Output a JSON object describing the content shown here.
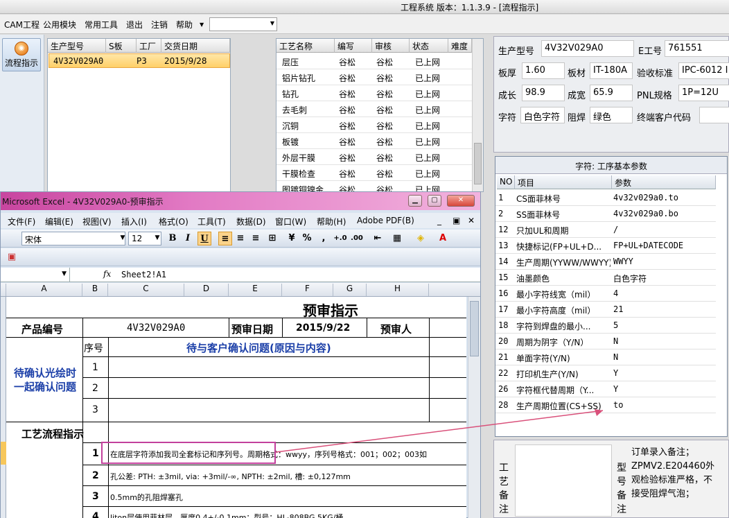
{
  "app": {
    "title": "工程系统   版本：1.1.3.9 - [流程指示]"
  },
  "menu": {
    "items": [
      "CAM工程",
      "公用模块",
      "常用工具",
      "退出",
      "注销",
      "帮助"
    ],
    "dropdown_value": ""
  },
  "sidebar": {
    "flow_button": "流程指示"
  },
  "orders": {
    "headers": [
      "生产型号",
      "S板",
      "工厂",
      "交货日期"
    ],
    "rows": [
      {
        "model": "4V32V029A0",
        "s": "",
        "factory": "P3",
        "date": "2015/9/28"
      }
    ]
  },
  "process": {
    "headers": [
      "工艺名称",
      "编写",
      "审核",
      "状态",
      "难度"
    ],
    "rows": [
      {
        "name": "层压",
        "writer": "谷松",
        "reviewer": "谷松",
        "status": "已上网"
      },
      {
        "name": "铝片钻孔",
        "writer": "谷松",
        "reviewer": "谷松",
        "status": "已上网"
      },
      {
        "name": "钻孔",
        "writer": "谷松",
        "reviewer": "谷松",
        "status": "已上网"
      },
      {
        "name": "去毛刺",
        "writer": "谷松",
        "reviewer": "谷松",
        "status": "已上网"
      },
      {
        "name": "沉铜",
        "writer": "谷松",
        "reviewer": "谷松",
        "status": "已上网"
      },
      {
        "name": "板镀",
        "writer": "谷松",
        "reviewer": "谷松",
        "status": "已上网"
      },
      {
        "name": "外层干膜",
        "writer": "谷松",
        "reviewer": "谷松",
        "status": "已上网"
      },
      {
        "name": "干膜检查",
        "writer": "谷松",
        "reviewer": "谷松",
        "status": "已上网"
      },
      {
        "name": "图镀铜镍金",
        "writer": "谷松",
        "reviewer": "谷松",
        "status": "已上网"
      }
    ]
  },
  "info": {
    "model_label": "生产型号",
    "model_value": "4V32V029A0",
    "eng_label": "E工号",
    "eng_value": "761551",
    "thickness_label": "板厚",
    "thickness_value": "1.60",
    "material_label": "板材",
    "material_value": "IT-180A",
    "standard_label": "验收标准",
    "standard_value": "IPC-6012 I",
    "length_label": "成长",
    "length_value": "98.9",
    "width_label": "成宽",
    "width_value": "65.9",
    "pnl_label": "PNL规格",
    "pnl_value": "1P=12U",
    "char_label": "字符",
    "char_value": "白色字符",
    "mask_label": "阻焊",
    "mask_value": "绿色",
    "customer_label": "终端客户代码",
    "customer_value": ""
  },
  "params": {
    "caption": "字符: 工序基本参数",
    "headers": [
      "NO",
      "项目",
      "参数"
    ],
    "rows": [
      {
        "no": "1",
        "item": "CS面菲林号",
        "value": "4v32v029a0.to"
      },
      {
        "no": "2",
        "item": "SS面菲林号",
        "value": "4v32v029a0.bo"
      },
      {
        "no": "12",
        "item": "只加UL和周期",
        "value": "/"
      },
      {
        "no": "13",
        "item": "快捷标记(FP+UL+D...",
        "value": "FP+UL+DATECODE"
      },
      {
        "no": "14",
        "item": "生产周期(YYWW/WWYY)",
        "value": "WWYY"
      },
      {
        "no": "15",
        "item": "油墨颜色",
        "value": "白色字符"
      },
      {
        "no": "16",
        "item": "最小字符线宽（mil）",
        "value": "4"
      },
      {
        "no": "17",
        "item": "最小字符高度（mil）",
        "value": "21"
      },
      {
        "no": "18",
        "item": "字符到焊盘的最小...",
        "value": "5"
      },
      {
        "no": "20",
        "item": "周期为阴字（Y/N）",
        "value": "N"
      },
      {
        "no": "21",
        "item": "单面字符(Y/N)",
        "value": "N"
      },
      {
        "no": "22",
        "item": "打印机生产(Y/N)",
        "value": "Y"
      },
      {
        "no": "26",
        "item": "字符框代替周期（Y...",
        "value": "Y"
      },
      {
        "no": "28",
        "item": "生产周期位置(CS+SS)",
        "value": "to"
      }
    ]
  },
  "notes": {
    "process_label": "工艺备注",
    "type_label": "型号备注",
    "order_note": "订单录入备注；ZPMV2.E204460外观检验标准严格，不接受阻焊气泡；"
  },
  "excel": {
    "title": "Microsoft Excel - 4V32V029A0-预审指示",
    "menus": [
      "文件(F)",
      "编辑(E)",
      "视图(V)",
      "插入(I)",
      "格式(O)",
      "工具(T)",
      "数据(D)",
      "窗口(W)",
      "帮助(H)",
      "Adobe PDF(B)"
    ],
    "font": "宋体",
    "size": "12",
    "formula": "Sheet2!A1",
    "fx": "fx",
    "columns": [
      "A",
      "B",
      "C",
      "D",
      "E",
      "F",
      "G",
      "H"
    ],
    "sheet": {
      "title": "预审指示",
      "product_label": "产品编号",
      "product_value": "4V32V029A0",
      "review_date_label": "预审日期",
      "review_date_value": "2015/9/22",
      "reviewer_label": "预审人",
      "pending_label": "待确认光绘时一起确认问题",
      "seq_label": "序号",
      "issue_header": "待与客户确认问题(原因与内容)",
      "seq": [
        "1",
        "2",
        "3"
      ],
      "flow_label": "工艺流程指示",
      "flow_rows": [
        {
          "no": "1",
          "text": "在底层字符添加我司全套标记和序列号。周期格式：wwyy，序列号格式：001；002；003如"
        },
        {
          "no": "2",
          "text": "孔公差:  PTH: ±3mil,  via: +3mil/-∞,  NPTH: ±2mil,  槽: ±0,127mm"
        },
        {
          "no": "3",
          "text": "0.5mm的孔阻焊塞孔"
        },
        {
          "no": "4",
          "text": "liton层使用菲林层，厚度0.4+/-0.1mm；型号：HL-808BG 5KG/桶"
        }
      ]
    }
  },
  "colors": {
    "accent": "#c2409c",
    "selection": "#ffd068",
    "blue_text": "#1b3fa8"
  }
}
